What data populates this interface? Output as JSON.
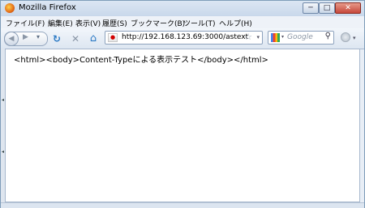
{
  "window": {
    "title": "Mozilla Firefox",
    "minimize": "─",
    "maximize": "□",
    "close": "✕"
  },
  "menu": [
    "ファイル(F)",
    "編集(E)",
    "表示(V)",
    "履歴(S)",
    "ブックマーク(B)",
    "ツール(T)",
    "ヘルプ(H)"
  ],
  "toolbar": {
    "back": "◀",
    "forward": "▶",
    "history_drop": "▾",
    "reload": "↻",
    "stop": "✕",
    "home": "⌂",
    "url": "http://192.168.123.69:3000/astext",
    "star": "☆",
    "url_drop": "▾",
    "search_placeholder": "Google",
    "search_icon": "⚲"
  },
  "content": {
    "text": "<html><body>Content-Typeによる表示テスト</body></html>"
  },
  "colors": {
    "reload": "#2a79c4",
    "stop": "#8a96a6",
    "home": "#2a79c4",
    "chrome": "#e8eef6"
  }
}
